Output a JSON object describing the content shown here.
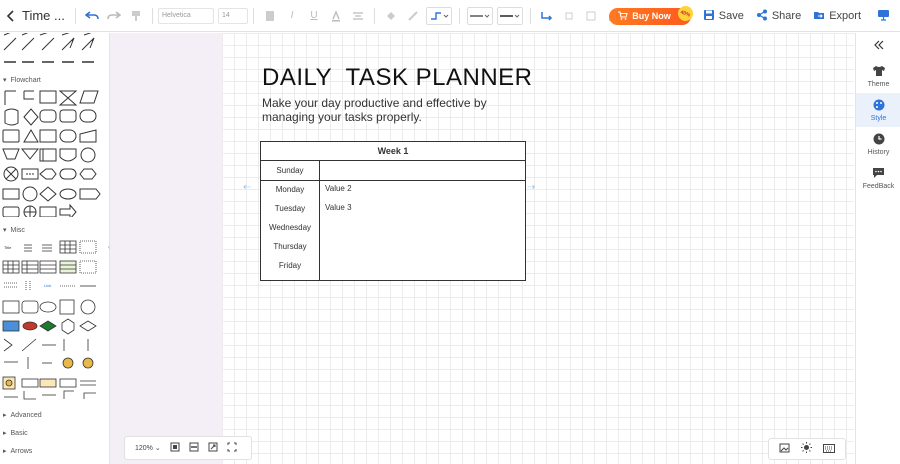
{
  "app": {
    "title": "Time ...",
    "font_family_select": "Helvetica",
    "font_size_select": "14"
  },
  "toolbar_right": {
    "buy_label": "Buy Now",
    "buy_badge": "40%",
    "save_label": "Save",
    "share_label": "Share",
    "export_label": "Export"
  },
  "left_panel": {
    "sections": [
      "Flowchart",
      "Misc",
      "Advanced",
      "Basic",
      "Arrows"
    ]
  },
  "right_panel": {
    "items": [
      {
        "label": "Theme",
        "icon": "shirt-icon"
      },
      {
        "label": "Style",
        "icon": "palette-icon"
      },
      {
        "label": "History",
        "icon": "clock-icon"
      },
      {
        "label": "FeedBack",
        "icon": "feedback-icon"
      }
    ]
  },
  "document": {
    "title": "DAILY  TASK PLANNER",
    "subtitle": "Make your day productive and effective by managing your tasks properly.",
    "table": {
      "header": "Week 1",
      "days": [
        "Sunday",
        "Monday",
        "Tuesday",
        "Wednesday",
        "Thursday",
        "Friday"
      ],
      "values": [
        "",
        "Value 2",
        "Value 3",
        "",
        "",
        ""
      ]
    }
  },
  "zoom": {
    "level": "120%"
  },
  "colors": {
    "accent": "#2f73d9",
    "buy": "#ff6a1f",
    "handle_bg": "#f4eef7"
  }
}
